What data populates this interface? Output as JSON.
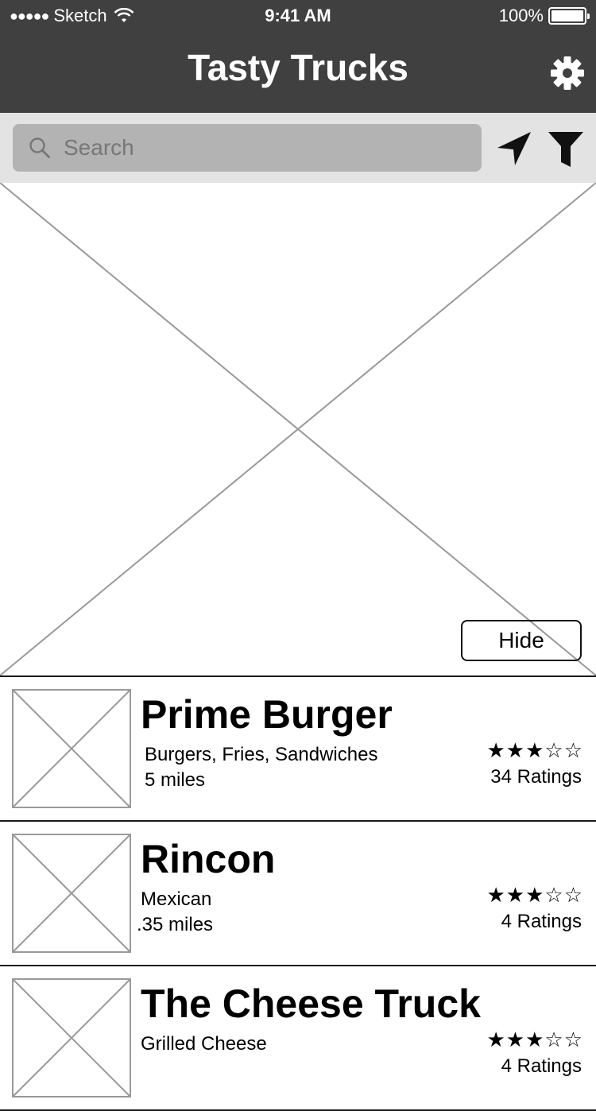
{
  "status_bar": {
    "signal": "●●●●●",
    "carrier": "Sketch",
    "time": "9:41 AM",
    "battery": "100%",
    "battery_level": 1.0
  },
  "header": {
    "title": "Tasty Trucks",
    "settings_icon": "gear-icon"
  },
  "search": {
    "placeholder": "Search",
    "value": "",
    "icon": "search-icon"
  },
  "toolbar": {
    "location_icon": "location-arrow-icon",
    "filter_icon": "funnel-filter-icon"
  },
  "map": {
    "hide_label": "Hide"
  },
  "trucks": [
    {
      "name": "Prime Burger",
      "cuisine": "Burgers, Fries, Sandwiches",
      "distance": "5 miles",
      "stars": "★★★☆☆",
      "rating": 3,
      "rating_max": 5,
      "ratings": "34 Ratings"
    },
    {
      "name": "Rincon",
      "cuisine": "Mexican",
      "distance": ".35 miles",
      "stars": "★★★☆☆",
      "rating": 3,
      "rating_max": 5,
      "ratings": "4 Ratings"
    },
    {
      "name": "The Cheese Truck",
      "cuisine": "Grilled Cheese",
      "distance": "",
      "stars": "★★★☆☆",
      "rating": 3,
      "rating_max": 5,
      "ratings": "4 Ratings"
    }
  ]
}
